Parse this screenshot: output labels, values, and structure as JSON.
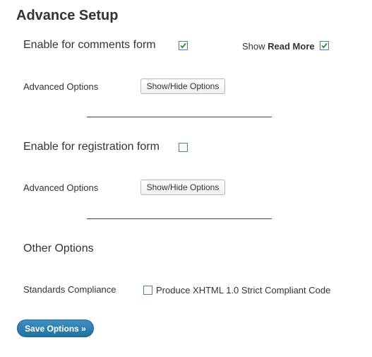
{
  "page": {
    "title": "Advance Setup"
  },
  "comments": {
    "enable_label": "Enable for comments form",
    "enable_checked": true,
    "show_prefix": "Show",
    "read_more_label": "Read More",
    "read_more_checked": true,
    "advanced_label": "Advanced Options",
    "toggle_button": "Show/Hide Options"
  },
  "registration": {
    "enable_label": "Enable for registration form",
    "enable_checked": false,
    "advanced_label": "Advanced Options",
    "toggle_button": "Show/Hide Options"
  },
  "other": {
    "heading": "Other Options",
    "standards_label": "Standards Compliance",
    "xhtml_label": "Produce XHTML 1.0 Strict Compliant Code",
    "xhtml_checked": false
  },
  "footer": {
    "save_label": "Save Options »"
  },
  "colors": {
    "checkbox_tick": "#2f8f2f",
    "save_button": "#21729f"
  }
}
